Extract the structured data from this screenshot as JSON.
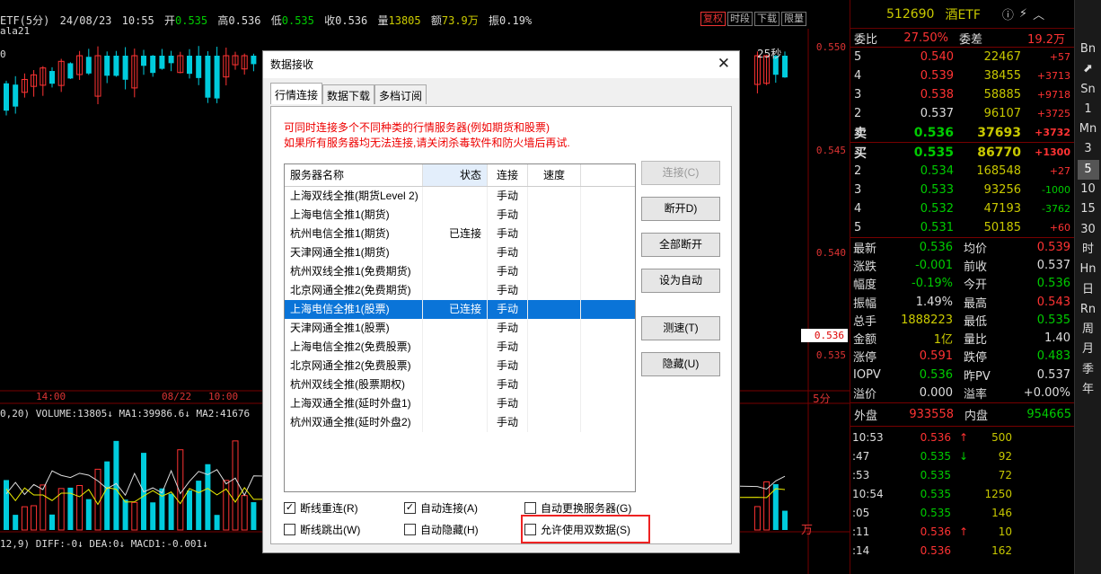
{
  "topbar": {
    "symbol": "ETF(5分)",
    "date": "24/08/23",
    "time": "10:55",
    "open_label": "开",
    "open": "0.535",
    "high_label": "高",
    "high": "0.536",
    "low_label": "低",
    "low": "0.535",
    "close_label": "收",
    "close": "0.536",
    "volume_label": "量",
    "volume": "13805",
    "amount_label": "额",
    "amount": "73.9万",
    "amplitude_label": "振",
    "amplitude": "0.19%",
    "indicator": "ala21",
    "tabs": [
      "复权",
      "时段",
      "下载",
      "限量"
    ],
    "countdown": "25秒"
  },
  "chart": {
    "price_labels": [
      "0.550",
      "0.545",
      "0.540",
      "0.536",
      "0.535"
    ],
    "time_labels": [
      "14:00",
      "08/22",
      "10:00"
    ],
    "period_label": "5分",
    "volume_legend": "0,20) VOLUME:13805↓ MA1:39986.6↓ MA2:41676",
    "macd_legend": "12,9) DIFF:-0↓ DEA:0↓ MACD1:-0.001↓",
    "unit": "万",
    "current_price": "0.536"
  },
  "quote": {
    "code": "512690",
    "name": "酒ETF",
    "weibi_label": "委比",
    "weibi": "27.50%",
    "weicha_label": "委差",
    "weicha": "19.2万",
    "sell": [
      {
        "level": "5",
        "price": "0.540",
        "vol": "22467",
        "chg": "+57"
      },
      {
        "level": "4",
        "price": "0.539",
        "vol": "38455",
        "chg": "+3713"
      },
      {
        "level": "3",
        "price": "0.538",
        "vol": "58885",
        "chg": "+9718"
      },
      {
        "level": "2",
        "price": "0.537",
        "vol": "96107",
        "chg": "+3725"
      },
      {
        "level": "卖",
        "price": "0.536",
        "vol": "37693",
        "chg": "+3732"
      }
    ],
    "buy": [
      {
        "level": "买",
        "price": "0.535",
        "vol": "86770",
        "chg": "+1300"
      },
      {
        "level": "2",
        "price": "0.534",
        "vol": "168548",
        "chg": "+27"
      },
      {
        "level": "3",
        "price": "0.533",
        "vol": "93256",
        "chg": "-1000"
      },
      {
        "level": "4",
        "price": "0.532",
        "vol": "47193",
        "chg": "-3762"
      },
      {
        "level": "5",
        "price": "0.531",
        "vol": "50185",
        "chg": "+60"
      }
    ],
    "stats": [
      {
        "k": "最新",
        "v": "0.536",
        "vc": "grn",
        "k2": "均价",
        "v2": "0.539",
        "v2c": "red"
      },
      {
        "k": "涨跌",
        "v": "-0.001",
        "vc": "grn",
        "k2": "前收",
        "v2": "0.537",
        "v2c": "wht"
      },
      {
        "k": "幅度",
        "v": "-0.19%",
        "vc": "grn",
        "k2": "今开",
        "v2": "0.536",
        "v2c": "grn"
      },
      {
        "k": "振幅",
        "v": "1.49%",
        "vc": "wht",
        "k2": "最高",
        "v2": "0.543",
        "v2c": "red"
      },
      {
        "k": "总手",
        "v": "1888223",
        "vc": "yel",
        "k2": "最低",
        "v2": "0.535",
        "v2c": "grn"
      },
      {
        "k": "金额",
        "v": "1亿",
        "vc": "yel",
        "k2": "量比",
        "v2": "1.40",
        "v2c": "wht"
      },
      {
        "k": "涨停",
        "v": "0.591",
        "vc": "red",
        "k2": "跌停",
        "v2": "0.483",
        "v2c": "grn"
      },
      {
        "k": "IOPV",
        "v": "0.536",
        "vc": "grn",
        "k2": "昨PV",
        "v2": "0.537",
        "v2c": "wht"
      },
      {
        "k": "溢价",
        "v": "0.000",
        "vc": "wht",
        "k2": "溢率",
        "v2": "+0.00%",
        "v2c": "wht"
      }
    ],
    "outer_label": "外盘",
    "outer": "933558",
    "inner_label": "内盘",
    "inner": "954665",
    "ticks": [
      {
        "t": "10:53",
        "p": "0.536",
        "ar": "↑",
        "arc": "red",
        "vol": "500"
      },
      {
        "t": ":47",
        "p": "0.535",
        "ar": "↓",
        "arc": "grn",
        "vol": "92"
      },
      {
        "t": ":53",
        "p": "0.535",
        "ar": "",
        "arc": "",
        "vol": "72"
      },
      {
        "t": "10:54",
        "p": "0.535",
        "ar": "",
        "arc": "",
        "vol": "1250"
      },
      {
        "t": ":05",
        "p": "0.535",
        "ar": "",
        "arc": "",
        "vol": "146"
      },
      {
        "t": ":11",
        "p": "0.536",
        "ar": "↑",
        "arc": "red",
        "vol": "10"
      },
      {
        "t": ":14",
        "p": "0.536",
        "ar": "",
        "arc": "",
        "vol": "162"
      }
    ]
  },
  "periods": [
    "Bn",
    "",
    "Sn",
    "1",
    "Mn",
    "3",
    "5",
    "10",
    "15",
    "30",
    "时",
    "Hn",
    "日",
    "Rn",
    "周",
    "月",
    "季",
    "年"
  ],
  "dialog": {
    "title": "数据接收",
    "tabs": [
      "行情连接",
      "数据下载",
      "多档订阅"
    ],
    "notice1": "可同时连接多个不同种类的行情服务器(例如期货和股票)",
    "notice2": "如果所有服务器均无法连接,请关闭杀毒软件和防火墙后再试.",
    "headers": [
      "服务器名称",
      "状态",
      "连接",
      "速度"
    ],
    "servers": [
      {
        "name": "上海双线全推(期货Level 2)",
        "status": "",
        "conn": "手动"
      },
      {
        "name": "上海电信全推1(期货)",
        "status": "",
        "conn": "手动"
      },
      {
        "name": "杭州电信全推1(期货)",
        "status": "已连接",
        "conn": "手动"
      },
      {
        "name": "天津网通全推1(期货)",
        "status": "",
        "conn": "手动"
      },
      {
        "name": "杭州双线全推1(免费期货)",
        "status": "",
        "conn": "手动"
      },
      {
        "name": "北京网通全推2(免费期货)",
        "status": "",
        "conn": "手动"
      },
      {
        "name": "上海电信全推1(股票)",
        "status": "已连接",
        "conn": "手动"
      },
      {
        "name": "天津网通全推1(股票)",
        "status": "",
        "conn": "手动"
      },
      {
        "name": "上海电信全推2(免费股票)",
        "status": "",
        "conn": "手动"
      },
      {
        "name": "北京网通全推2(免费股票)",
        "status": "",
        "conn": "手动"
      },
      {
        "name": "杭州双线全推(股票期权)",
        "status": "",
        "conn": "手动"
      },
      {
        "name": "上海双通全推(延时外盘1)",
        "status": "",
        "conn": "手动"
      },
      {
        "name": "杭州双通全推(延时外盘2)",
        "status": "",
        "conn": "手动"
      }
    ],
    "buttons": {
      "connect": "连接(C)",
      "disconnect": "断开D)",
      "disconnect_all": "全部断开",
      "set_auto": "设为自动",
      "speed_test": "测速(T)",
      "hide": "隐藏(U)"
    },
    "checks": {
      "reconnect": "断线重连(R)",
      "auto_connect": "自动连接(A)",
      "auto_switch": "自动更换服务器(G)",
      "drop_jump": "断线跳出(W)",
      "auto_hide": "自动隐藏(H)",
      "dual_data": "允许使用双数据(S)"
    }
  }
}
